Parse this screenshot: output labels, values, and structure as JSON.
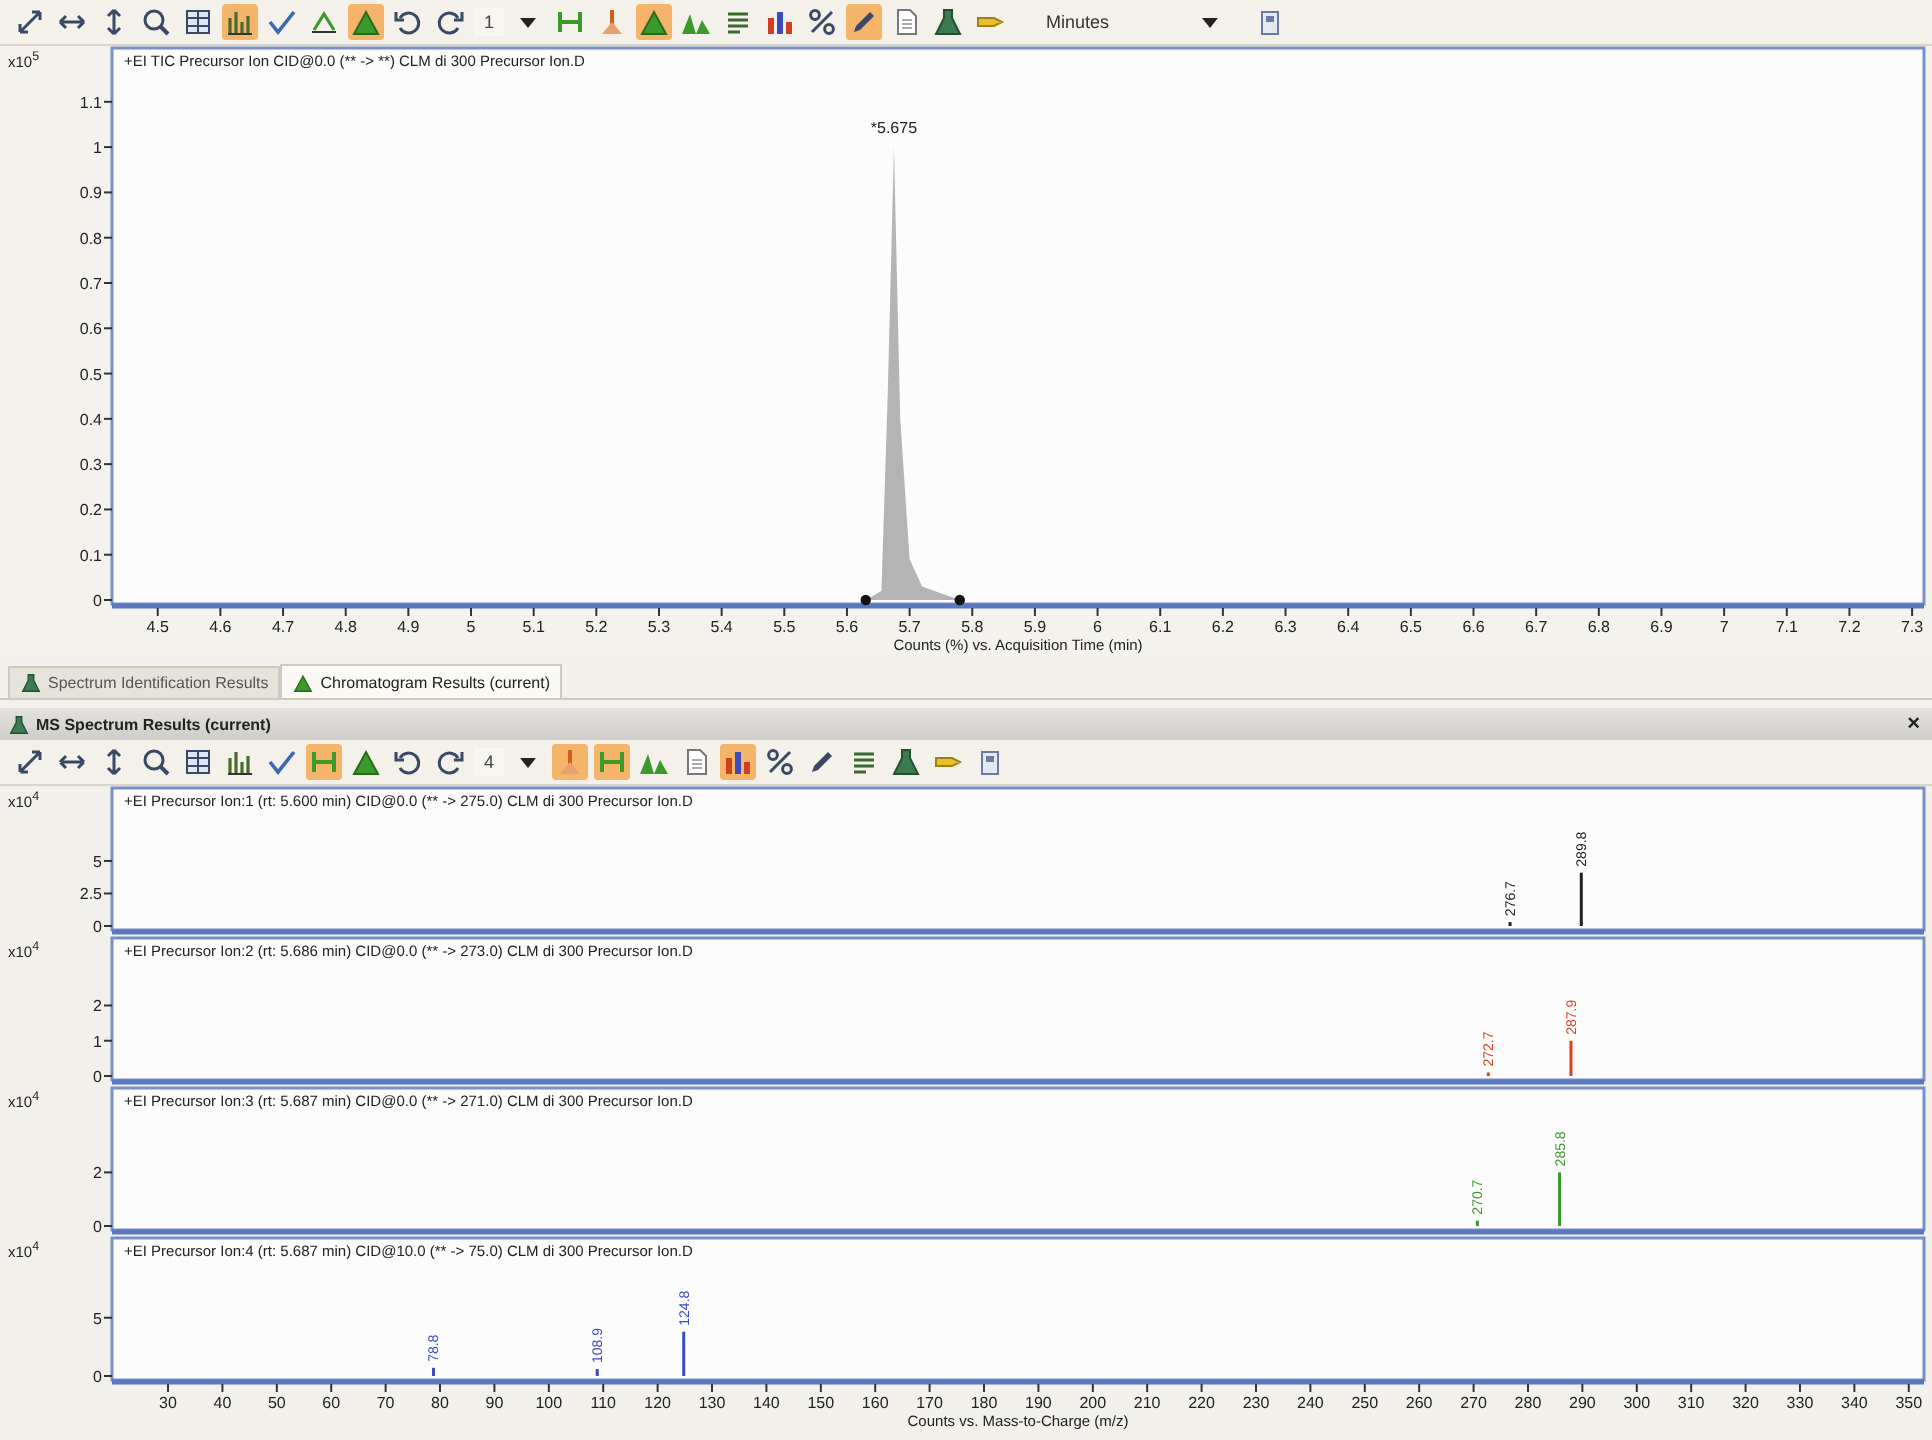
{
  "toolbar": {
    "items": [
      {
        "kind": "move",
        "on": false
      },
      {
        "kind": "hsize",
        "on": false
      },
      {
        "kind": "vsize",
        "on": false
      },
      {
        "kind": "zoom",
        "on": false
      },
      {
        "kind": "grid",
        "on": false
      },
      {
        "kind": "spectrum",
        "on": true
      },
      {
        "kind": "check",
        "on": false
      },
      {
        "kind": "baseline",
        "on": false
      },
      {
        "kind": "peak",
        "on": true
      },
      {
        "kind": "undo",
        "on": false
      },
      {
        "kind": "redo",
        "on": false
      },
      {
        "kind": "count",
        "text": "1"
      },
      {
        "kind": "dropdown",
        "on": false
      },
      {
        "kind": "range",
        "on": false
      },
      {
        "kind": "marker",
        "on": false
      },
      {
        "kind": "peak",
        "on": true
      },
      {
        "kind": "peaks",
        "on": false
      },
      {
        "kind": "list",
        "on": false
      },
      {
        "kind": "bars",
        "on": false
      },
      {
        "kind": "percent",
        "on": false
      },
      {
        "kind": "tool",
        "on": true
      },
      {
        "kind": "page",
        "on": false
      },
      {
        "kind": "flask",
        "on": false
      },
      {
        "kind": "label",
        "on": false
      },
      {
        "kind": "select",
        "text": "Minutes"
      },
      {
        "kind": "save",
        "on": false
      }
    ]
  },
  "chromatogram": {
    "y_scale": "x10$^{5}$",
    "chart_data": {
      "type": "area",
      "title": "+EI TIC Precursor Ion CID@0.0 (** -> **) CLM di 300 Precursor Ion.D",
      "xlabel": "Counts (%) vs. Acquisition Time (min)",
      "x": [
        4.43,
        5.63,
        5.655,
        5.665,
        5.675,
        5.685,
        5.7,
        5.72,
        5.78,
        7.319
      ],
      "series": [
        {
          "color": "#b4b4b4",
          "values": [
            0,
            0,
            0.02,
            0.45,
            1.0,
            0.4,
            0.09,
            0.03,
            0,
            0
          ]
        }
      ],
      "xlim": [
        4.427,
        7.319
      ],
      "ylim": [
        0,
        1.21
      ],
      "xticks": [
        {
          "value": 4.5,
          "label": "4.5"
        },
        {
          "value": 4.6,
          "label": "4.6"
        },
        {
          "value": 4.7,
          "label": "4.7"
        },
        {
          "value": 4.8,
          "label": "4.8"
        },
        {
          "value": 4.9,
          "label": "4.9"
        },
        {
          "value": 5,
          "label": "5"
        },
        {
          "value": 5.1,
          "label": "5.1"
        },
        {
          "value": 5.2,
          "label": "5.2"
        },
        {
          "value": 5.3,
          "label": "5.3"
        },
        {
          "value": 5.4,
          "label": "5.4"
        },
        {
          "value": 5.5,
          "label": "5.5"
        },
        {
          "value": 5.6,
          "label": "5.6"
        },
        {
          "value": 5.7,
          "label": "5.7"
        },
        {
          "value": 5.8,
          "label": "5.8"
        },
        {
          "value": 5.9,
          "label": "5.9"
        },
        {
          "value": 6,
          "label": "6"
        },
        {
          "value": 6.1,
          "label": "6.1"
        },
        {
          "value": 6.2,
          "label": "6.2"
        },
        {
          "value": 6.3,
          "label": "6.3"
        },
        {
          "value": 6.4,
          "label": "6.4"
        },
        {
          "value": 6.5,
          "label": "6.5"
        },
        {
          "value": 6.6,
          "label": "6.6"
        },
        {
          "value": 6.7,
          "label": "6.7"
        },
        {
          "value": 6.8,
          "label": "6.8"
        },
        {
          "value": 6.9,
          "label": "6.9"
        },
        {
          "value": 7,
          "label": "7"
        },
        {
          "value": 7.1,
          "label": "7.1"
        },
        {
          "value": 7.2,
          "label": "7.2"
        },
        {
          "value": 7.3,
          "label": "7.3"
        }
      ],
      "yticks": [
        {
          "value": 0,
          "label": "0"
        },
        {
          "value": 0.1,
          "label": "0.1"
        },
        {
          "value": 0.2,
          "label": "0.2"
        },
        {
          "value": 0.3,
          "label": "0.3"
        },
        {
          "value": 0.4,
          "label": "0.4"
        },
        {
          "value": 0.5,
          "label": "0.5"
        },
        {
          "value": 0.6,
          "label": "0.6"
        },
        {
          "value": 0.7,
          "label": "0.7"
        },
        {
          "value": 0.8,
          "label": "0.8"
        },
        {
          "value": 0.9,
          "label": "0.9"
        },
        {
          "value": 1,
          "label": "1"
        },
        {
          "value": 1.1,
          "label": "1.1"
        }
      ],
      "annotations": [
        {
          "x": 5.675,
          "y": 1.0,
          "text": "*5.675"
        }
      ]
    }
  },
  "tabs": [
    {
      "label": "Spectrum Identification Results",
      "selected": false
    },
    {
      "label": "Chromatogram Results (current)",
      "selected": true
    }
  ],
  "spectrum_panel": {
    "title": "MS Spectrum Results (current)",
    "close": "×",
    "toolbar": {
      "items": [
        {
          "kind": "move",
          "on": false
        },
        {
          "kind": "hsize",
          "on": false
        },
        {
          "kind": "vsize",
          "on": false
        },
        {
          "kind": "zoom",
          "on": false
        },
        {
          "kind": "grid",
          "on": false
        },
        {
          "kind": "spectrum",
          "on": false
        },
        {
          "kind": "check",
          "on": false
        },
        {
          "kind": "range",
          "on": true
        },
        {
          "kind": "peak",
          "on": false
        },
        {
          "kind": "undo",
          "on": false
        },
        {
          "kind": "redo",
          "on": false
        },
        {
          "kind": "count",
          "text": "4"
        },
        {
          "kind": "dropdown",
          "on": false
        },
        {
          "kind": "marker",
          "on": true
        },
        {
          "kind": "range",
          "on": true
        },
        {
          "kind": "peaks",
          "on": false
        },
        {
          "kind": "page",
          "on": false
        },
        {
          "kind": "bars",
          "on": true
        },
        {
          "kind": "percent",
          "on": false
        },
        {
          "kind": "tool",
          "on": false
        },
        {
          "kind": "list",
          "on": false
        },
        {
          "kind": "flask",
          "on": false
        },
        {
          "kind": "label",
          "on": false
        },
        {
          "kind": "save",
          "on": false
        }
      ]
    },
    "spectra": [
      {
        "y_scale": "x10$^{4}$",
        "chart_data": {
          "type": "bar",
          "title": "+EI Precursor Ion:1 (rt: 5.600 min) CID@0.0 (** -> 275.0) CLM di 300 Precursor Ion.D",
          "x": [
            276.7,
            289.8
          ],
          "series": [
            {
              "color": "#202020",
              "values": [
                0.3,
                4.1
              ]
            }
          ],
          "value_labels": [
            "276.7",
            "289.8"
          ],
          "xlim": [
            19.7,
            352.8
          ],
          "ylim": [
            0,
            10.3
          ],
          "yticks": [
            {
              "value": 0,
              "label": "0"
            },
            {
              "value": 2.5,
              "label": "2.5"
            },
            {
              "value": 5,
              "label": "5"
            }
          ]
        }
      },
      {
        "y_scale": "x10$^{4}$",
        "chart_data": {
          "type": "bar",
          "title": "+EI Precursor Ion:2 (rt: 5.686 min) CID@0.0 (** -> 273.0) CLM di 300 Precursor Ion.D",
          "x": [
            272.7,
            287.9
          ],
          "series": [
            {
              "color": "#e0401c",
              "values": [
                0.1,
                1.0
              ]
            }
          ],
          "value_labels": [
            "272.7",
            "287.9"
          ],
          "xlim": [
            19.7,
            352.8
          ],
          "ylim": [
            0,
            3.8
          ],
          "yticks": [
            {
              "value": 0,
              "label": "0"
            },
            {
              "value": 1,
              "label": "1"
            },
            {
              "value": 2,
              "label": "2"
            }
          ]
        }
      },
      {
        "y_scale": "x10$^{4}$",
        "chart_data": {
          "type": "bar",
          "title": "+EI Precursor Ion:3 (rt: 5.687 min) CID@0.0 (** -> 271.0) CLM di 300 Precursor Ion.D",
          "x": [
            270.7,
            285.8
          ],
          "series": [
            {
              "color": "#3c9a2c",
              "values": [
                0.2,
                2.0
              ]
            }
          ],
          "value_labels": [
            "270.7",
            "285.8"
          ],
          "xlim": [
            19.7,
            352.8
          ],
          "ylim": [
            0,
            5
          ],
          "yticks": [
            {
              "value": 0,
              "label": "0"
            },
            {
              "value": 2,
              "label": "2"
            }
          ]
        }
      },
      {
        "y_scale": "x10$^{4}$",
        "chart_data": {
          "type": "bar",
          "title": "+EI Precursor Ion:4 (rt: 5.687 min) CID@10.0 (** -> 75.0) CLM di 300 Precursor Ion.D",
          "xlabel": "Counts vs. Mass-to-Charge (m/z)",
          "x": [
            78.8,
            108.9,
            124.8
          ],
          "series": [
            {
              "color": "#3a4cc0",
              "values": [
                0.7,
                0.6,
                3.8
              ]
            }
          ],
          "value_labels": [
            "78.8",
            "108.9",
            "124.8"
          ],
          "xlim": [
            19.7,
            352.8
          ],
          "ylim": [
            0,
            11.5
          ],
          "yticks": [
            {
              "value": 0,
              "label": "0"
            },
            {
              "value": 5,
              "label": "5"
            }
          ],
          "xticks": [
            {
              "value": 30,
              "label": "30"
            },
            {
              "value": 40,
              "label": "40"
            },
            {
              "value": 50,
              "label": "50"
            },
            {
              "value": 60,
              "label": "60"
            },
            {
              "value": 70,
              "label": "70"
            },
            {
              "value": 80,
              "label": "80"
            },
            {
              "value": 90,
              "label": "90"
            },
            {
              "value": 100,
              "label": "100"
            },
            {
              "value": 110,
              "label": "110"
            },
            {
              "value": 120,
              "label": "120"
            },
            {
              "value": 130,
              "label": "130"
            },
            {
              "value": 140,
              "label": "140"
            },
            {
              "value": 150,
              "label": "150"
            },
            {
              "value": 160,
              "label": "160"
            },
            {
              "value": 170,
              "label": "170"
            },
            {
              "value": 180,
              "label": "180"
            },
            {
              "value": 190,
              "label": "190"
            },
            {
              "value": 200,
              "label": "200"
            },
            {
              "value": 210,
              "label": "210"
            },
            {
              "value": 220,
              "label": "220"
            },
            {
              "value": 230,
              "label": "230"
            },
            {
              "value": 240,
              "label": "240"
            },
            {
              "value": 250,
              "label": "250"
            },
            {
              "value": 260,
              "label": "260"
            },
            {
              "value": 270,
              "label": "270"
            },
            {
              "value": 280,
              "label": "280"
            },
            {
              "value": 290,
              "label": "290"
            },
            {
              "value": 300,
              "label": "300"
            },
            {
              "value": 310,
              "label": "310"
            },
            {
              "value": 320,
              "label": "320"
            },
            {
              "value": 330,
              "label": "330"
            },
            {
              "value": 340,
              "label": "340"
            },
            {
              "value": 350,
              "label": "350"
            }
          ]
        }
      }
    ]
  }
}
